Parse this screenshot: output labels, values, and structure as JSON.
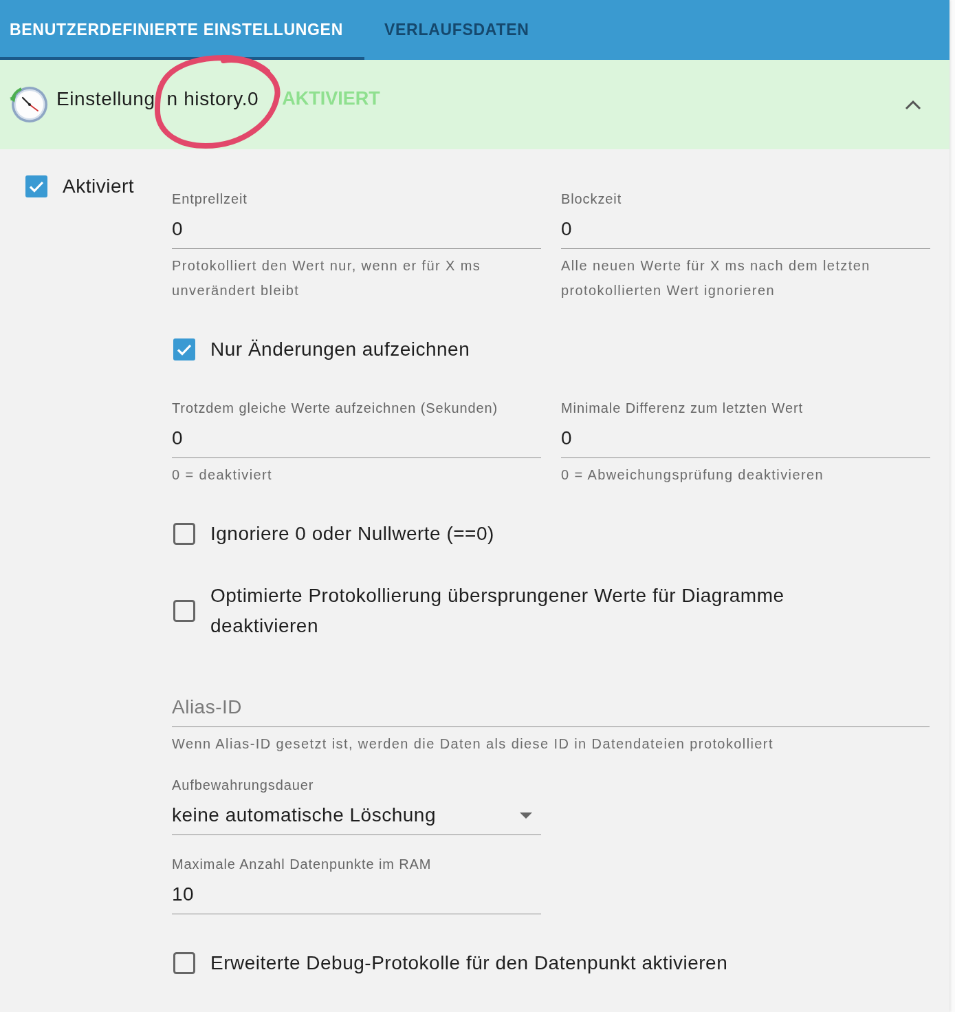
{
  "tabs": [
    {
      "label": "BENUTZERDEFINIERTE EINSTELLUNGEN",
      "selected": true
    },
    {
      "label": "VERLAUFSDATEN",
      "selected": false
    }
  ],
  "panel": {
    "title_visible_parts": [
      "Einstellung",
      "n history.0"
    ],
    "status": "AKTIVIERT",
    "expanded": true
  },
  "enabled": {
    "label": "Aktiviert",
    "checked": true
  },
  "settings": [
    {
      "kind": "field-pair",
      "fields": [
        {
          "label": "Entprellzeit",
          "value": "0",
          "helper": "Protokolliert den Wert nur, wenn er für X ms unverändert bleibt"
        },
        {
          "label": "Blockzeit",
          "value": "0",
          "helper": "Alle neuen Werte für X ms nach dem letzten protokollierten Wert ignorieren"
        }
      ]
    },
    {
      "kind": "checkbox",
      "label": "Nur Änderungen aufzeichnen",
      "checked": true
    },
    {
      "kind": "field-pair",
      "fields": [
        {
          "label": "Trotzdem gleiche Werte aufzeichnen (Sekunden)",
          "value": "0",
          "helper": "0 = deaktiviert"
        },
        {
          "label": "Minimale Differenz zum letzten Wert",
          "value": "0",
          "helper": "0 = Abweichungsprüfung deaktivieren"
        }
      ]
    },
    {
      "kind": "checkbox",
      "label": "Ignoriere 0 oder Nullwerte (==0)",
      "checked": false
    },
    {
      "kind": "checkbox",
      "label": "Optimierte Protokollierung übersprungener Werte für Diagramme deaktivieren",
      "checked": false
    },
    {
      "kind": "text-field",
      "placeholder": "Alias-ID",
      "helper": "Wenn Alias-ID gesetzt ist, werden die Daten als diese ID in Datendateien protokolliert"
    },
    {
      "kind": "select",
      "label": "Aufbewahrungsdauer",
      "value": "keine automatische Löschung"
    },
    {
      "kind": "text-field",
      "label": "Maximale Anzahl Datenpunkte im RAM",
      "value": "10"
    },
    {
      "kind": "checkbox",
      "label": "Erweiterte Debug-Protokolle für den Datenpunkt aktivieren",
      "checked": false
    }
  ]
}
